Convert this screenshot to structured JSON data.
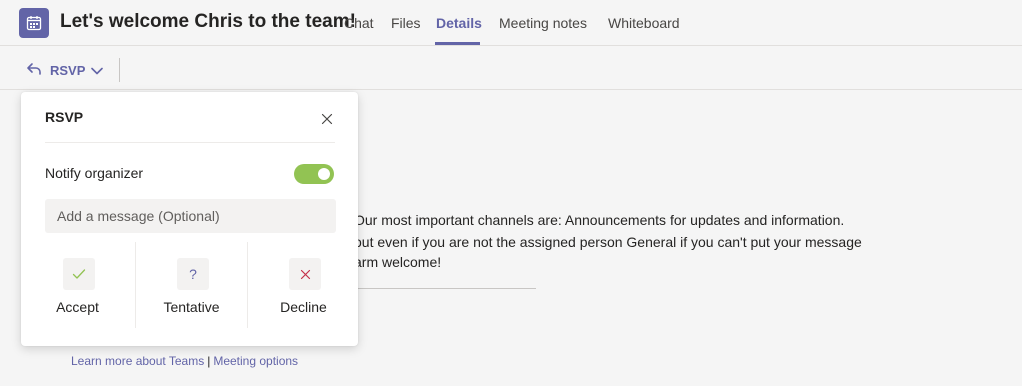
{
  "header": {
    "title": "Let's welcome Chris to the team!",
    "tabs": [
      {
        "label": "Chat"
      },
      {
        "label": "Files"
      },
      {
        "label": "Details"
      },
      {
        "label": "Meeting notes"
      },
      {
        "label": "Whiteboard"
      }
    ]
  },
  "toolbar": {
    "rsvp_label": "RSVP"
  },
  "background": {
    "line1": "Our most important channels are: Announcements for updates and information.",
    "line2": "out even if you are not the assigned person General if you can't put your message",
    "line3": "arm welcome!"
  },
  "footer": {
    "learn_more": "Learn more about Teams",
    "separator": "|",
    "meeting_options": "Meeting options"
  },
  "rsvp_panel": {
    "title": "RSVP",
    "notify_label": "Notify organizer",
    "notify_enabled": true,
    "message_placeholder": "Add a message (Optional)",
    "options": [
      {
        "label": "Accept",
        "icon": "check-icon",
        "symbol": "✓",
        "color": "#92c353"
      },
      {
        "label": "Tentative",
        "icon": "question-icon",
        "symbol": "?",
        "color": "#6264a7"
      },
      {
        "label": "Decline",
        "icon": "x-icon",
        "symbol": "✕",
        "color": "#c4314b"
      }
    ]
  }
}
